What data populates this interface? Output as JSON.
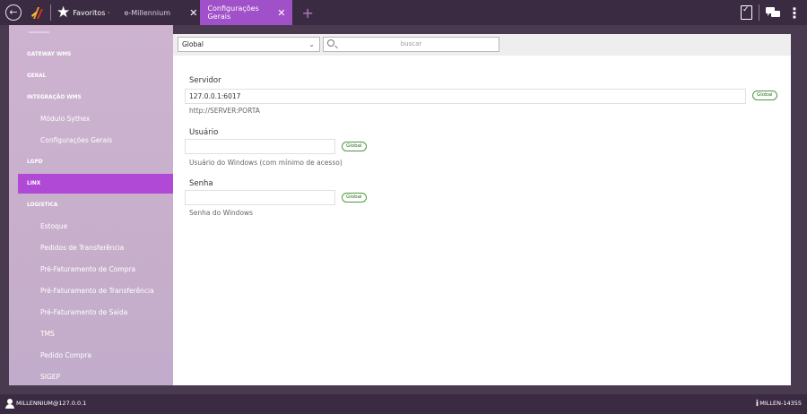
{
  "topbar": {
    "favorites_label": "Favoritos ·",
    "tabs": [
      {
        "label": "e-Millennium",
        "active": false
      },
      {
        "label": "Configurações Gerais",
        "active": true
      }
    ],
    "close_glyph": "✕",
    "add_tab_glyph": "+"
  },
  "sidebar": {
    "items": [
      {
        "label": "GATEWAY WMS",
        "type": "group"
      },
      {
        "label": "GERAL",
        "type": "group"
      },
      {
        "label": "INTEGRAÇÃO WMS",
        "type": "group"
      },
      {
        "label": "Módulo Sythex",
        "type": "sub"
      },
      {
        "label": "Configurações Gerais",
        "type": "sub"
      },
      {
        "label": "LGPD",
        "type": "group"
      },
      {
        "label": "LINX",
        "type": "group",
        "active": true
      },
      {
        "label": "LOGISTICA",
        "type": "group"
      },
      {
        "label": "Estoque",
        "type": "sub"
      },
      {
        "label": "Pedidos de Transferência",
        "type": "sub"
      },
      {
        "label": "Pré-Faturamento de Compra",
        "type": "sub"
      },
      {
        "label": "Pré-Faturamento de Transferência",
        "type": "sub"
      },
      {
        "label": "Pré-Faturamento de Saída",
        "type": "sub"
      },
      {
        "label": "TMS",
        "type": "sub"
      },
      {
        "label": "Pedido Compra",
        "type": "sub"
      },
      {
        "label": "SIGEP",
        "type": "sub"
      }
    ]
  },
  "filter": {
    "scope_value": "Global",
    "search_placeholder": "buscar"
  },
  "form": {
    "servidor": {
      "label": "Servidor",
      "value": "127.0.0.1:6017",
      "hint": "http://SERVER:PORTA",
      "badge": "Global"
    },
    "usuario": {
      "label": "Usuário",
      "value": "",
      "hint": "Usuário do Windows (com mínimo de acesso)",
      "badge": "Global"
    },
    "senha": {
      "label": "Senha",
      "value": "",
      "hint": "Senha do Windows",
      "badge": "Global"
    }
  },
  "statusbar": {
    "user": "MILLENNIUM@127.0.0.1",
    "build": "MILLEN-14355"
  },
  "colors": {
    "topbar_bg": "#3b2b42",
    "active_tab": "#a050c8",
    "sidebar_active": "#b04ad6",
    "badge_border": "#4c9a3f"
  },
  "icons": [
    "back-icon",
    "millennium-logo",
    "star-icon",
    "close-icon",
    "plus-icon",
    "clipboard-check-icon",
    "chat-icon",
    "more-vertical-icon",
    "chevron-down-icon",
    "search-icon",
    "user-icon",
    "info-icon"
  ]
}
